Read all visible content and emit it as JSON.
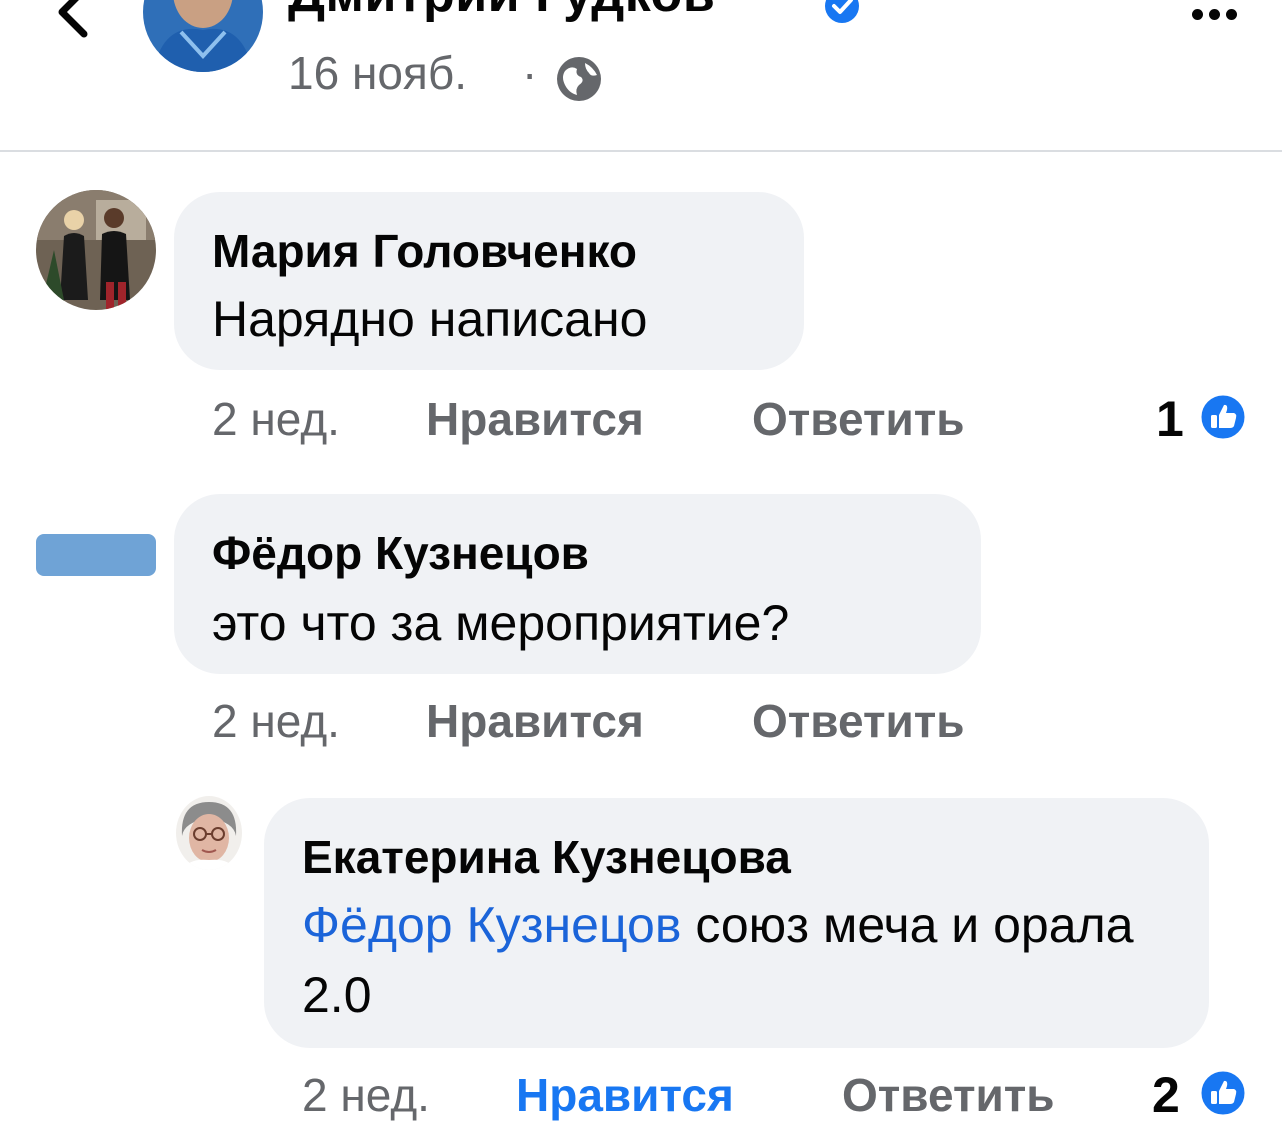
{
  "post": {
    "author": "Дмитрий Гудков",
    "date": "16 нояб.",
    "separator": "·",
    "icons": {
      "back": "back-chevron-icon",
      "verified": "verified-badge-icon",
      "audience": "globe-icon",
      "more": "more-dots-icon"
    }
  },
  "comments": [
    {
      "author": "Мария Головченко",
      "text": "Нарядно написано",
      "time": "2 нед.",
      "like_label": "Нравится",
      "reply_label": "Ответить",
      "reaction_count": "1",
      "reaction_icon": "like-thumb-icon",
      "liked": false
    },
    {
      "author": "Фёдор Кузнецов",
      "text": "это что за мероприятие?",
      "time": "2 нед.",
      "like_label": "Нравится",
      "reply_label": "Ответить",
      "liked": false
    }
  ],
  "reply": {
    "author": "Екатерина Кузнецова",
    "mention": "Фёдор Кузнецов",
    "text": " союз меча и орала 2.0",
    "time": "2 нед.",
    "like_label": "Нравится",
    "reply_label": "Ответить",
    "reaction_count": "2",
    "reaction_icon": "like-thumb-icon",
    "liked": true
  },
  "colors": {
    "bubble": "#f0f2f5",
    "meta": "#65676b",
    "accent": "#1877f2",
    "mention": "#1b64d9",
    "divider": "#dadde1"
  }
}
